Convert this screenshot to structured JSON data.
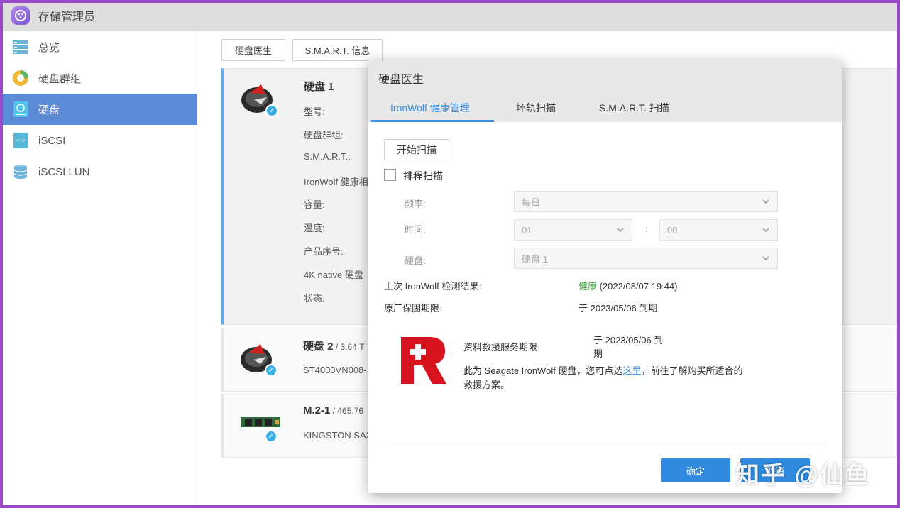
{
  "app": {
    "title": "存储管理员"
  },
  "sidebar": {
    "items": [
      {
        "label": "总览",
        "icon": "overview-icon"
      },
      {
        "label": "硬盘群组",
        "icon": "disk-group-icon"
      },
      {
        "label": "硬盘",
        "icon": "disk-icon",
        "active": true
      },
      {
        "label": "iSCSI",
        "icon": "iscsi-icon"
      },
      {
        "label": "iSCSI LUN",
        "icon": "iscsi-lun-icon"
      }
    ]
  },
  "toolbar": {
    "disk_doctor": "硬盘医生",
    "smart_info": "S.M.A.R.T. 信息"
  },
  "disks": [
    {
      "title": "硬盘 1",
      "fields": [
        "型号:",
        "硬盘群组:",
        "S.M.A.R.T.:",
        "IronWolf 健康相",
        "容量:",
        "温度:",
        "产品序号:",
        "4K native 硬盘",
        "状态:"
      ]
    },
    {
      "title": "硬盘 2",
      "size": " / 3.64 T",
      "model": "ST4000VN008-"
    },
    {
      "title": "M.2-1",
      "size": " / 465.76",
      "model": "KINGSTON SA2"
    }
  ],
  "dialog": {
    "title": "硬盘医生",
    "tabs": [
      "IronWolf 健康管理",
      "坏轨扫描",
      "S.M.A.R.T. 扫描"
    ],
    "start_scan": "开始扫描",
    "schedule_label": "排程扫描",
    "frequency_label": "频率:",
    "frequency_value": "每日",
    "time_label": "时间:",
    "hour_value": "01",
    "time_sep": ":",
    "minute_value": "00",
    "disk_label": "硬盘:",
    "disk_value": "硬盘 1",
    "last_result_label": "上次 IronWolf 检测结果:",
    "last_result_status": "健康",
    "last_result_date": " (2022/08/07 19:44)",
    "warranty_label": "原厂保固期限:",
    "warranty_value": "于 2023/05/06 到期",
    "rescue_label": "资料救援服务期限:",
    "rescue_value_line1": "于 2023/05/06 到",
    "rescue_value_line2": "期",
    "rescue_desc_pre": "此为 Seagate IronWolf 硬盘，您可点选",
    "rescue_desc_link": "这里",
    "rescue_desc_post": "，前往了解购买所适合的",
    "rescue_desc_line2": "救援方案。",
    "ok": "确定",
    "cancel": "取消"
  },
  "watermark": "知乎 @仙鱼",
  "colors": {
    "accent": "#2f8ae0",
    "sidebar_active": "#5b8ad6",
    "healthy": "#3aa83a",
    "frame": "#9a49c8"
  }
}
